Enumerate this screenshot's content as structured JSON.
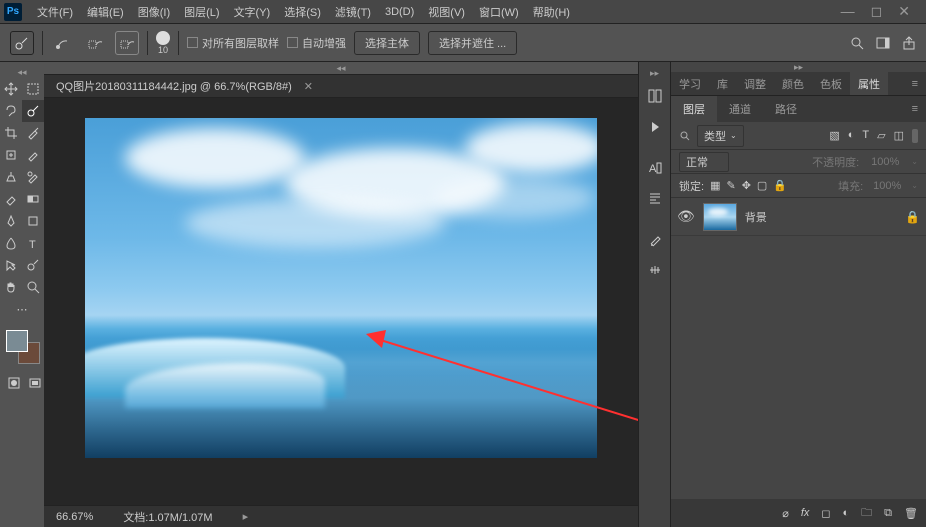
{
  "app": {
    "name": "Ps"
  },
  "menu": [
    "文件(F)",
    "编辑(E)",
    "图像(I)",
    "图层(L)",
    "文字(Y)",
    "选择(S)",
    "滤镜(T)",
    "3D(D)",
    "视图(V)",
    "窗口(W)",
    "帮助(H)"
  ],
  "options": {
    "brush_size": "10",
    "sample_all": "对所有图层取样",
    "auto_enhance": "自动增强",
    "select_subject": "选择主体",
    "select_and_mask": "选择并遮住 ..."
  },
  "document": {
    "tab_title": "QQ图片20180311184442.jpg @ 66.7%(RGB/8#)",
    "zoom": "66.67%",
    "doc_info": "文档:1.07M/1.07M"
  },
  "panels": {
    "top_tabs": [
      "学习",
      "库",
      "调整",
      "颜色",
      "色板",
      "属性"
    ],
    "top_active": 5,
    "layer_tabs": [
      "图层",
      "通道",
      "路径"
    ],
    "layer_active": 0,
    "type_filter": "类型",
    "blend_mode": "正常",
    "opacity_label": "不透明度:",
    "opacity_value": "100%",
    "lock_label": "锁定:",
    "fill_label": "填充:",
    "fill_value": "100%",
    "layers": [
      {
        "name": "背景",
        "locked": true
      }
    ]
  },
  "colors": {
    "fg": "#7a8b94",
    "bg": "#6b4a3a"
  }
}
